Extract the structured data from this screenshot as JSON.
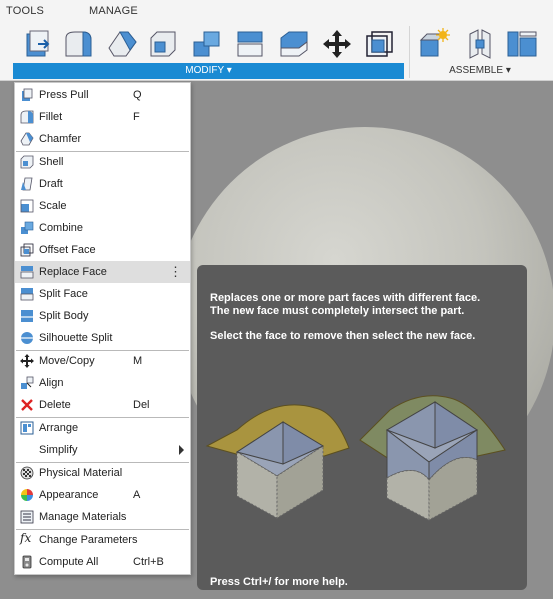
{
  "toolbar": {
    "tabs": [
      "TOOLS",
      "MANAGE"
    ],
    "modify_label": "MODIFY",
    "assemble_label": "ASSEMBLE",
    "tools": [
      "press-pull-icon",
      "fillet-icon",
      "chamfer-icon",
      "shell-icon",
      "combine-icon",
      "replace-face-icon",
      "split-face-icon",
      "move-copy-icon",
      "offset-face-icon",
      "new-component-icon",
      "joint-icon",
      "assemble-panel-icon"
    ]
  },
  "menu": {
    "items": [
      {
        "label": "Press Pull",
        "shortcut": "Q"
      },
      {
        "label": "Fillet",
        "shortcut": "F"
      },
      {
        "label": "Chamfer",
        "shortcut": ""
      },
      {
        "label": "Shell",
        "shortcut": ""
      },
      {
        "label": "Draft",
        "shortcut": ""
      },
      {
        "label": "Scale",
        "shortcut": ""
      },
      {
        "label": "Combine",
        "shortcut": ""
      },
      {
        "label": "Offset Face",
        "shortcut": ""
      },
      {
        "label": "Replace Face",
        "shortcut": "",
        "highlighted": true
      },
      {
        "label": "Split Face",
        "shortcut": ""
      },
      {
        "label": "Split Body",
        "shortcut": ""
      },
      {
        "label": "Silhouette Split",
        "shortcut": ""
      },
      {
        "label": "Move/Copy",
        "shortcut": "M"
      },
      {
        "label": "Align",
        "shortcut": ""
      },
      {
        "label": "Delete",
        "shortcut": "Del"
      },
      {
        "label": "Arrange",
        "shortcut": ""
      },
      {
        "label": "Simplify",
        "shortcut": ""
      },
      {
        "label": "Physical Material",
        "shortcut": ""
      },
      {
        "label": "Appearance",
        "shortcut": "A"
      },
      {
        "label": "Manage Materials",
        "shortcut": ""
      },
      {
        "label": "Change Parameters",
        "shortcut": ""
      },
      {
        "label": "Compute All",
        "shortcut": "Ctrl+B"
      }
    ]
  },
  "tooltip": {
    "line1": "Replaces one or more part faces with different face.",
    "line2": "The new face must completely intersect the part.",
    "line3": "Select the face to remove then select the new face.",
    "help": "Press Ctrl+/ for more help."
  },
  "colors": {
    "accent": "#1a8ad3",
    "menu_highlight": "#dedede",
    "tooltip_bg": "#5b5b5b",
    "viewport_bg": "#8e8e8e"
  }
}
